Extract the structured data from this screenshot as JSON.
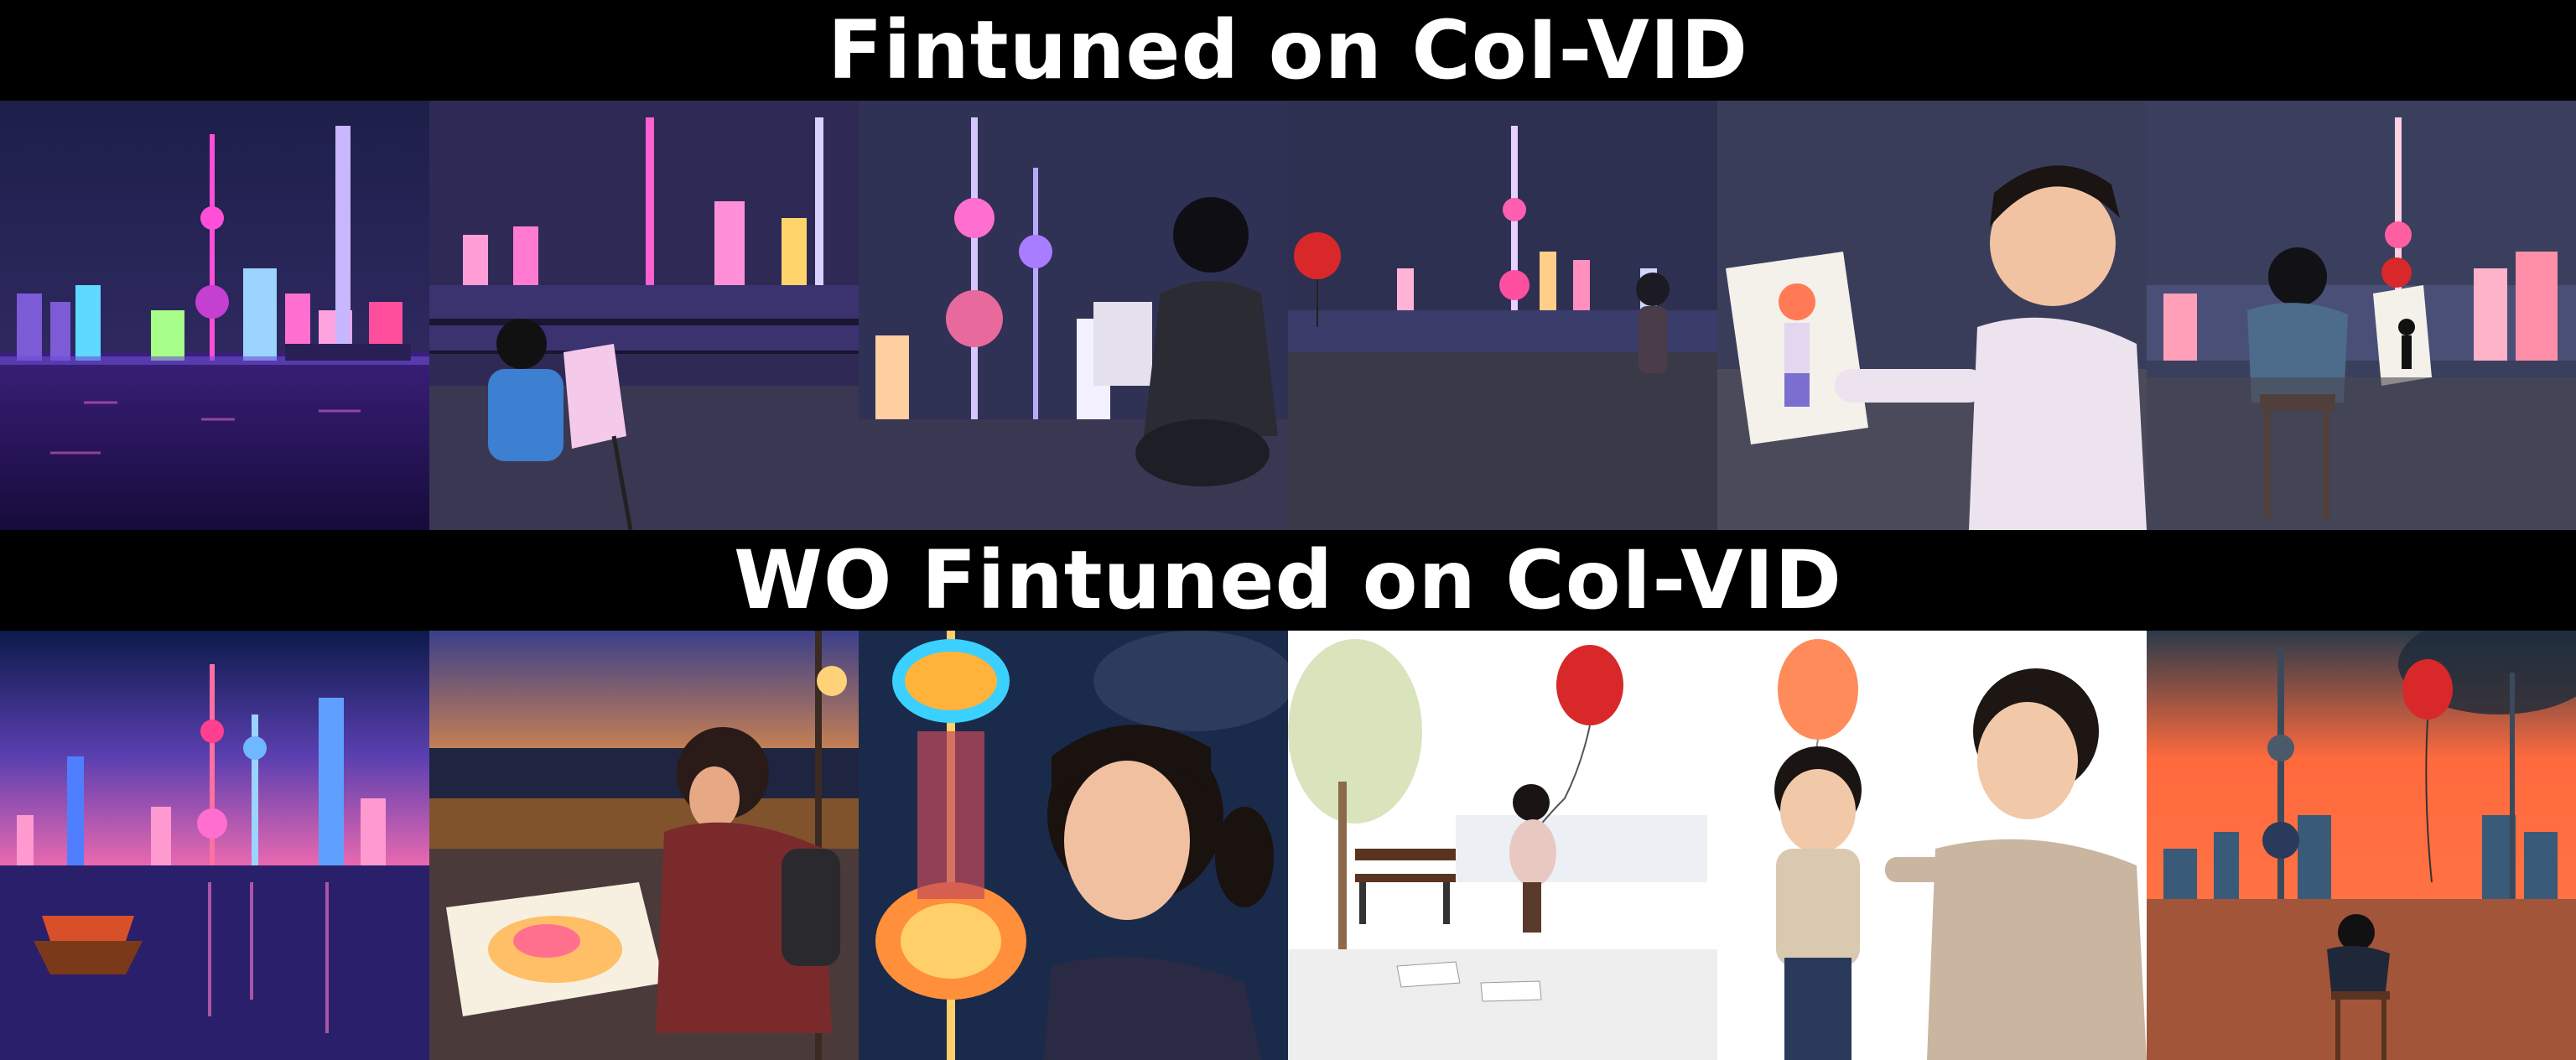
{
  "banners": {
    "top": "Fintuned on CoI-VID",
    "bottom": "WO Fintuned on CoI-VID"
  },
  "rows": {
    "top": {
      "frames": [
        {
          "scene": "night-skyline-river"
        },
        {
          "scene": "girl-painting-at-easel-by-river"
        },
        {
          "scene": "woman-sitting-facing-tower"
        },
        {
          "scene": "child-with-red-balloon-on-promenade"
        },
        {
          "scene": "boy-showing-drawing"
        },
        {
          "scene": "child-drawing-on-stool"
        }
      ]
    },
    "bottom": {
      "frames": [
        {
          "scene": "colorful-skyline-with-boat"
        },
        {
          "scene": "girl-painting-at-sunset"
        },
        {
          "scene": "girl-looking-at-tower"
        },
        {
          "scene": "girl-with-balloon-sketch"
        },
        {
          "scene": "two-boys-with-balloon-sketch"
        },
        {
          "scene": "boy-on-stool-red-sky"
        }
      ]
    }
  },
  "colors": {
    "background": "#000000",
    "text": "#ffffff",
    "night_sky": "#2b2b55",
    "neon_pink": "#ff4fd8",
    "balloon_red": "#d8282a",
    "sunset_orange": "#ff6a3d"
  }
}
